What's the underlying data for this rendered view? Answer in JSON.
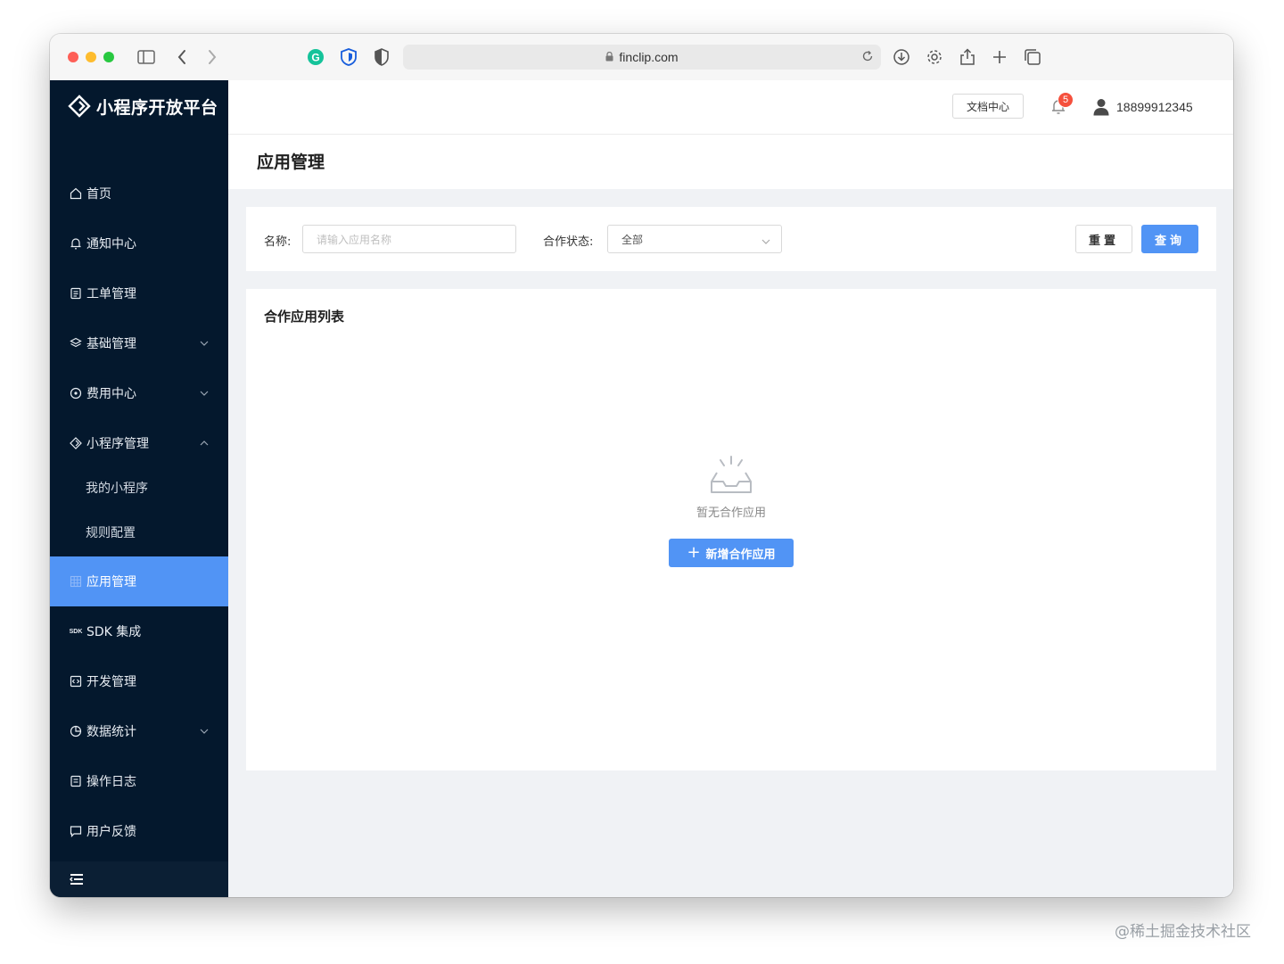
{
  "browser": {
    "url": "finclip.com"
  },
  "sidebar": {
    "brand": "小程序开放平台",
    "items": [
      {
        "label": "首页",
        "icon": "home-icon"
      },
      {
        "label": "通知中心",
        "icon": "bell-icon"
      },
      {
        "label": "工单管理",
        "icon": "document-icon"
      },
      {
        "label": "基础管理",
        "icon": "layers-icon",
        "expanded": false
      },
      {
        "label": "费用中心",
        "icon": "coin-icon",
        "expanded": false
      },
      {
        "label": "小程序管理",
        "icon": "diamond-icon",
        "expanded": true
      },
      {
        "label": "应用管理",
        "icon": "grid-icon",
        "active": true
      },
      {
        "label": "SDK 集成",
        "icon": "sdk-icon"
      },
      {
        "label": "开发管理",
        "icon": "code-icon"
      },
      {
        "label": "数据统计",
        "icon": "pie-chart-icon",
        "expanded": false
      },
      {
        "label": "操作日志",
        "icon": "log-icon"
      },
      {
        "label": "用户反馈",
        "icon": "message-icon"
      }
    ],
    "subitems": [
      {
        "label": "我的小程序"
      },
      {
        "label": "规则配置"
      }
    ],
    "sdk_icon_text": "SDK"
  },
  "header": {
    "doc_center": "文档中心",
    "notification_count": "5",
    "username": "18899912345"
  },
  "page": {
    "title": "应用管理"
  },
  "filter": {
    "name_label": "名称:",
    "name_placeholder": "请输入应用名称",
    "status_label": "合作状态:",
    "status_value": "全部",
    "reset_label": "重置",
    "query_label": "查询"
  },
  "list": {
    "title": "合作应用列表",
    "empty_text": "暂无合作应用",
    "add_button": "新增合作应用"
  },
  "watermark": "@稀土掘金技术社区",
  "colors": {
    "sidebar_bg": "#04182d",
    "accent": "#5194f5",
    "badge": "#f5503d"
  }
}
